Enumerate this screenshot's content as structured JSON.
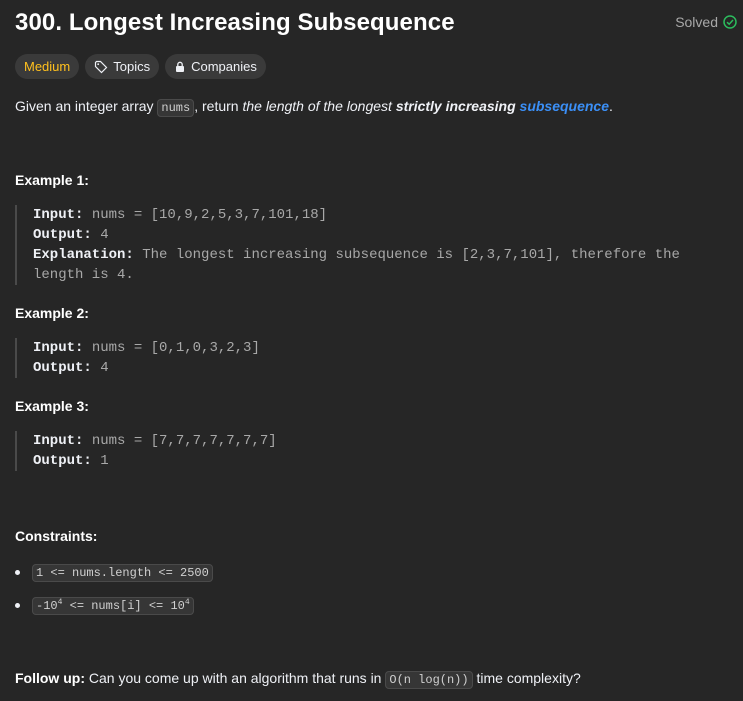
{
  "header": {
    "title": "300. Longest Increasing Subsequence",
    "status": "Solved"
  },
  "tags": {
    "difficulty": "Medium",
    "topics": "Topics",
    "companies": "Companies"
  },
  "description": {
    "p1": "Given an integer array ",
    "code1": "nums",
    "p2": ", return ",
    "p3": "the length of the longest ",
    "p4": "strictly increasing",
    "p5": " ",
    "link": "subsequence",
    "p6": "."
  },
  "examples": [
    {
      "title": "Example 1:",
      "input_label": "Input:",
      "input": " nums = [10,9,2,5,3,7,101,18]",
      "output_label": "Output:",
      "output": " 4",
      "explanation_label": "Explanation:",
      "explanation": " The longest increasing subsequence is [2,3,7,101], therefore the length is 4."
    },
    {
      "title": "Example 2:",
      "input_label": "Input:",
      "input": " nums = [0,1,0,3,2,3]",
      "output_label": "Output:",
      "output": " 4"
    },
    {
      "title": "Example 3:",
      "input_label": "Input:",
      "input": " nums = [7,7,7,7,7,7,7]",
      "output_label": "Output:",
      "output": " 1"
    }
  ],
  "constraints": {
    "title": "Constraints:",
    "c1": "1 <= nums.length <= 2500",
    "c2_pre": "-10",
    "c2_exp1": "4",
    "c2_mid": " <= nums[i] <= 10",
    "c2_exp2": "4"
  },
  "follow_up": {
    "label": "Follow up:",
    "text1": " Can you come up with an algorithm that runs in ",
    "code": "O(n log(n))",
    "text2": " time complexity?"
  },
  "colors": {
    "background": "#262626",
    "medium": "#ffc01e",
    "solved_check": "#2cbb5d",
    "link": "#3b8ff6"
  },
  "icons": [
    "check-circle-icon",
    "tag-icon",
    "lock-icon"
  ]
}
